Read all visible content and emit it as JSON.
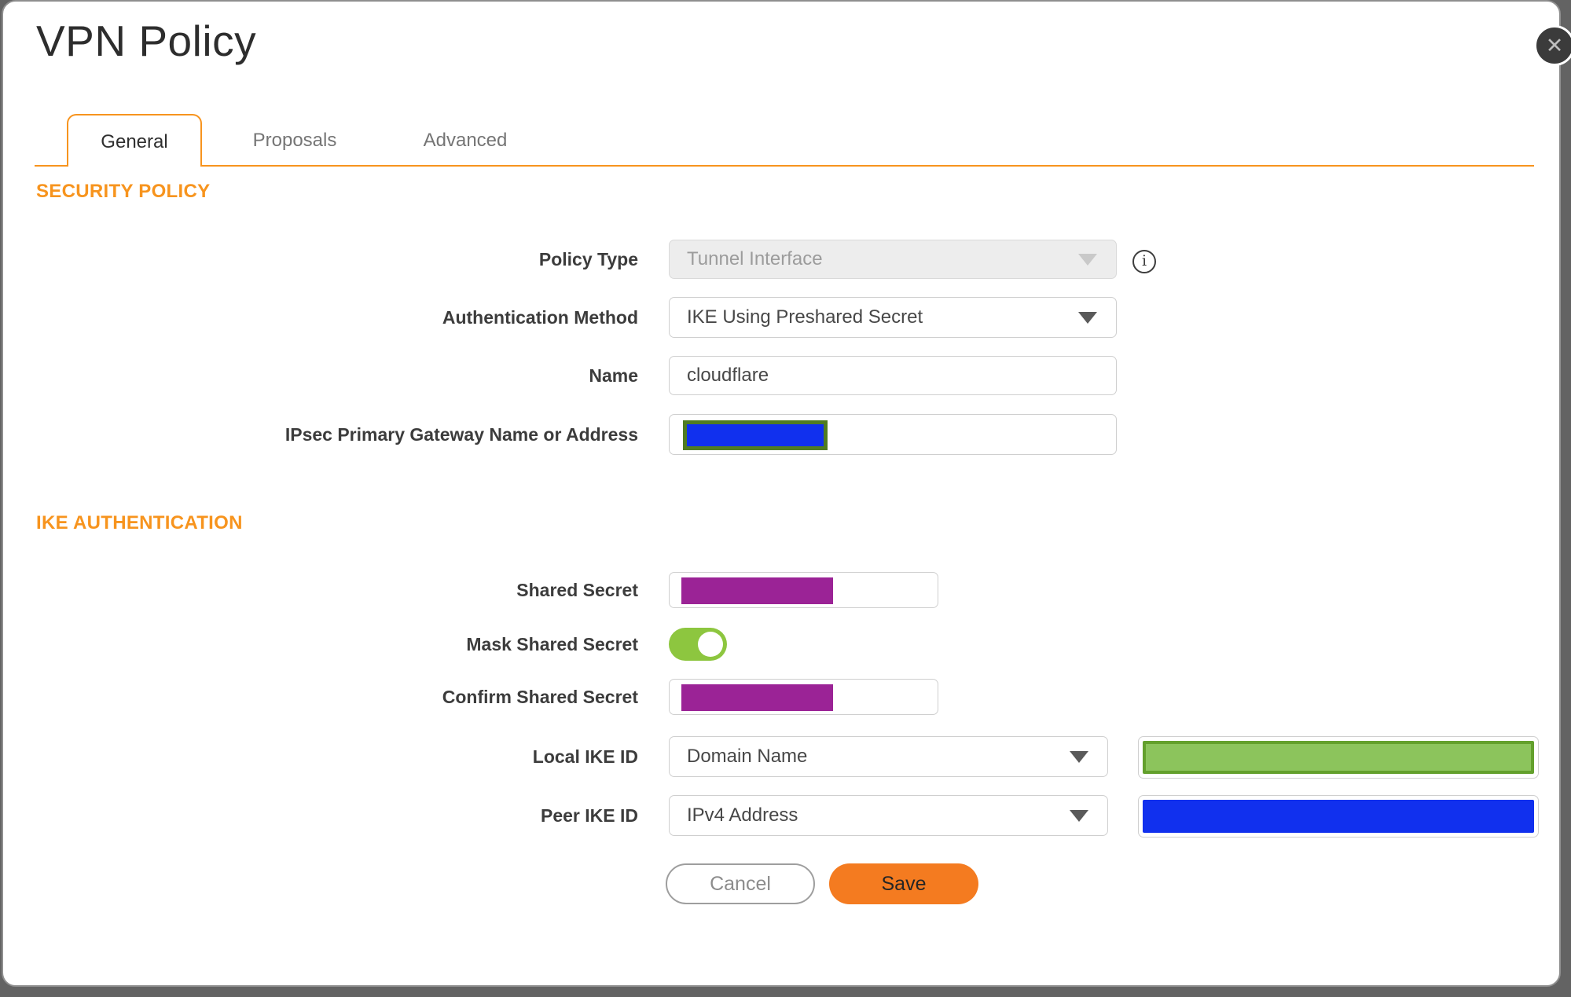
{
  "dialog": {
    "title": "VPN Policy"
  },
  "icons": {
    "close": "✕",
    "info": "i"
  },
  "tabs": [
    {
      "label": "General",
      "active": true
    },
    {
      "label": "Proposals",
      "active": false
    },
    {
      "label": "Advanced",
      "active": false
    }
  ],
  "sections": {
    "security_policy": "SECURITY POLICY",
    "ike_authentication": "IKE AUTHENTICATION"
  },
  "fields": {
    "policy_type": {
      "label": "Policy Type",
      "value": "Tunnel Interface",
      "disabled": true
    },
    "auth_method": {
      "label": "Authentication Method",
      "value": "IKE Using Preshared Secret"
    },
    "name": {
      "label": "Name",
      "value": "cloudflare"
    },
    "gateway": {
      "label": "IPsec Primary Gateway Name or Address",
      "value": "",
      "redacted": true
    },
    "shared_secret": {
      "label": "Shared Secret",
      "value": "",
      "redacted": true
    },
    "mask_shared_secret": {
      "label": "Mask Shared Secret",
      "state": "on"
    },
    "confirm_shared_secret": {
      "label": "Confirm Shared Secret",
      "value": "",
      "redacted": true
    },
    "local_ike_id": {
      "label": "Local IKE ID",
      "value": "Domain Name",
      "id_value_redacted": true
    },
    "peer_ike_id": {
      "label": "Peer IKE ID",
      "value": "IPv4 Address",
      "id_value_redacted": true
    }
  },
  "buttons": {
    "cancel": "Cancel",
    "save": "Save"
  },
  "colors": {
    "accent_orange": "#F7941E",
    "save_orange": "#F47B20",
    "redaction_purple": "#9B2396",
    "redaction_blue": "#1130EE",
    "redaction_olive_border": "#507C22",
    "redaction_green_fill": "#8CC45C",
    "redaction_green_border": "#63A02C",
    "toggle_green": "#8DC63F",
    "backdrop_gray": "#636363"
  }
}
